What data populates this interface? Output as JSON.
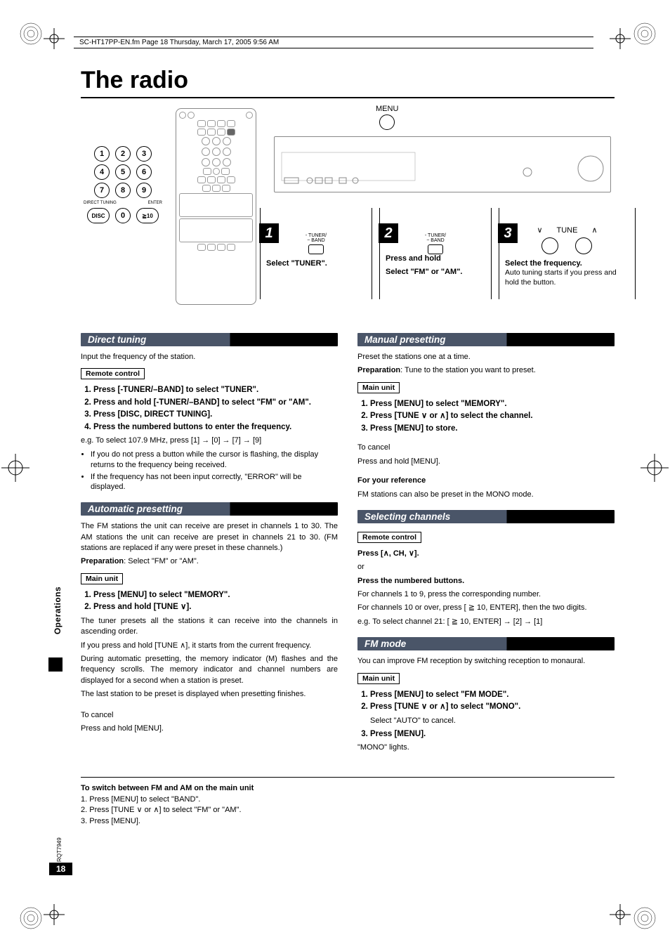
{
  "print_header": "SC-HT17PP-EN.fm  Page 18  Thursday, March 17, 2005  9:56 AM",
  "title": "The radio",
  "menu_label": "MENU",
  "remote_numpad_labels": {
    "direct_tuning": "DIRECT TUNING",
    "enter": "ENTER",
    "disc": "DISC"
  },
  "numpad": [
    "1",
    "2",
    "3",
    "4",
    "5",
    "6",
    "7",
    "8",
    "9",
    "0",
    "≧10"
  ],
  "steps": {
    "s1": {
      "label": "- TUNER/\n− BAND",
      "caption": "Select \"TUNER\"."
    },
    "s2": {
      "label": "- TUNER/\n− BAND",
      "pre": "Press and hold",
      "caption": "Select \"FM\" or \"AM\"."
    },
    "s3": {
      "tune": "TUNE",
      "caption": "Select the frequency.",
      "sub": "Auto tuning starts if you press and hold the button."
    }
  },
  "sections": {
    "direct_tuning": {
      "head": "Direct tuning",
      "intro": "Input the frequency of the station.",
      "box": "Remote control",
      "list": [
        "Press [-TUNER/–BAND] to select \"TUNER\".",
        "Press and hold [-TUNER/–BAND] to select \"FM\" or \"AM\".",
        "Press [DISC, DIRECT TUNING].",
        "Press the numbered buttons to enter the frequency."
      ],
      "eg": "e.g. To select 107.9 MHz, press [1] → [0] → [7] → [9]",
      "bullets": [
        "If you do not press a button while the cursor is flashing, the display returns to the frequency being received.",
        "If the frequency has not been input correctly, \"ERROR\" will be displayed."
      ]
    },
    "auto_preset": {
      "head": "Automatic presetting",
      "p1": "The FM stations the unit can receive are preset in channels 1 to 30. The AM stations the unit can receive are preset in channels 21 to 30. (FM stations are replaced if any were preset in these channels.)",
      "prep_label": "Preparation",
      "prep_text": ": Select \"FM\" or \"AM\".",
      "box": "Main unit",
      "list": [
        "Press [MENU] to select \"MEMORY\".",
        "Press and hold [TUNE ∨]."
      ],
      "p2": "The tuner presets all the stations it can receive into the channels in ascending order.",
      "p3": "If you press and hold [TUNE ∧], it starts from the current frequency.",
      "p4": "During automatic presetting, the memory indicator (M) flashes and the frequency scrolls. The memory indicator and channel numbers are displayed for a second when a station is preset.",
      "p5": "The last station to be preset is displayed when presetting finishes.",
      "cancel_h": "To cancel",
      "cancel_t": "Press and hold [MENU]."
    },
    "manual_preset": {
      "head": "Manual presetting",
      "intro": "Preset the stations one at a time.",
      "prep_label": "Preparation",
      "prep_text": ": Tune to the station you want to preset.",
      "box": "Main unit",
      "list": [
        "Press [MENU] to select \"MEMORY\".",
        "Press [TUNE ∨ or ∧] to select the channel.",
        "Press [MENU] to store."
      ],
      "cancel_h": "To cancel",
      "cancel_t": "Press and hold [MENU].",
      "ref_h": "For your reference",
      "ref_t": "FM stations can also be preset in the MONO mode."
    },
    "select_ch": {
      "head": "Selecting channels",
      "box": "Remote control",
      "l1": "Press [∧, CH, ∨].",
      "or": "or",
      "l2": "Press the numbered buttons.",
      "t1": "For channels 1 to 9, press the corresponding number.",
      "t2": "For channels 10 or over, press [ ≧ 10, ENTER], then the two digits.",
      "t3": "e.g. To select channel 21: [ ≧ 10, ENTER] → [2] → [1]"
    },
    "fm_mode": {
      "head": "FM mode",
      "intro": "You can improve FM reception by switching reception to monaural.",
      "box": "Main unit",
      "list": [
        "Press [MENU] to select \"FM MODE\".",
        "Press [TUNE ∨ or ∧] to select \"MONO\".",
        "Press [MENU]."
      ],
      "sub1": "Select \"AUTO\" to cancel.",
      "after": "\"MONO\" lights."
    }
  },
  "footer": {
    "title": "To switch between FM and AM on the main unit",
    "lines": [
      "1. Press [MENU] to select \"BAND\".",
      "2. Press [TUNE ∨ or ∧] to select \"FM\" or \"AM\".",
      "3. Press [MENU]."
    ]
  },
  "side_tab": "Operations",
  "rqt": "RQT7949",
  "page_num": "18"
}
